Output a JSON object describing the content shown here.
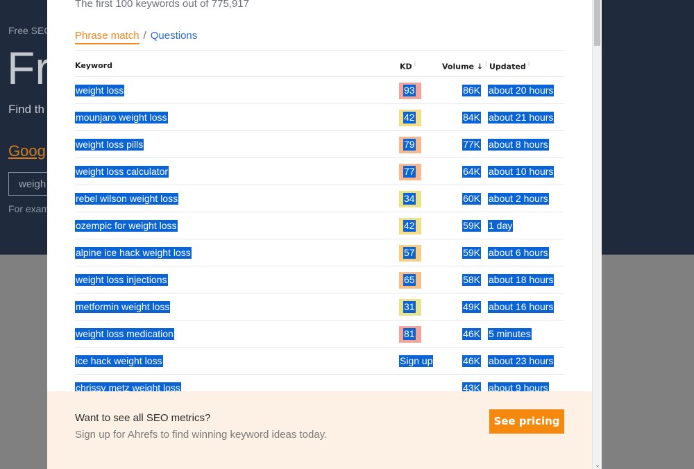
{
  "background": {
    "breadcrumb": "Free SEC",
    "title": "Fr",
    "subtitle": "Find th",
    "google_link": "Goog",
    "input_value": "weigh",
    "example": "For exam"
  },
  "modal": {
    "header": "The first 100 keywords out of 775,917",
    "tabs": {
      "active": "Phrase match",
      "separator": "/",
      "other": "Questions"
    },
    "columns": {
      "keyword": "Keyword",
      "kd": "KD",
      "volume": "Volume ↓",
      "updated": "Updated",
      "info": "i"
    },
    "rows": [
      {
        "keyword": "weight loss",
        "kd": "93",
        "kd_color": "#f2a69b",
        "volume": "86K",
        "updated": "about 20 hours"
      },
      {
        "keyword": "mounjaro weight loss",
        "kd": "42",
        "kd_color": "#f3df8a",
        "volume": "84K",
        "updated": "about 21 hours"
      },
      {
        "keyword": "weight loss pills",
        "kd": "79",
        "kd_color": "#f7b98f",
        "volume": "77K",
        "updated": "about 8 hours"
      },
      {
        "keyword": "weight loss calculator",
        "kd": "77",
        "kd_color": "#f7b98f",
        "volume": "64K",
        "updated": "about 10 hours"
      },
      {
        "keyword": "rebel wilson weight loss",
        "kd": "34",
        "kd_color": "#e9e38a",
        "volume": "60K",
        "updated": "about 2 hours"
      },
      {
        "keyword": "ozempic for weight loss",
        "kd": "42",
        "kd_color": "#f3df8a",
        "volume": "59K",
        "updated": "1 day"
      },
      {
        "keyword": "alpine ice hack weight loss",
        "kd": "57",
        "kd_color": "#f6cf85",
        "volume": "59K",
        "updated": "about 6 hours"
      },
      {
        "keyword": "weight loss injections",
        "kd": "65",
        "kd_color": "#f7bf8a",
        "volume": "58K",
        "updated": "about 18 hours"
      },
      {
        "keyword": "metformin weight loss",
        "kd": "31",
        "kd_color": "#e6e48e",
        "volume": "49K",
        "updated": "about 16 hours"
      },
      {
        "keyword": "weight loss medication",
        "kd": "81",
        "kd_color": "#f2a69b",
        "volume": "46K",
        "updated": "5 minutes"
      },
      {
        "keyword": "ice hack weight loss",
        "kd": "Sign up",
        "kd_color": "",
        "volume": "46K",
        "updated": "about 23 hours"
      },
      {
        "keyword": "chrissy metz weight loss",
        "kd": "",
        "kd_color": "",
        "volume": "43K",
        "updated": "about 9 hours"
      }
    ],
    "footer": {
      "title": "Want to see all SEO metrics?",
      "subtitle": "Sign up for Ahrefs to find winning keyword ideas today.",
      "cta": "See pricing"
    }
  },
  "colors": {
    "accent": "#f5891f",
    "selection": "#0a64d6",
    "link": "#2e6cd1"
  }
}
